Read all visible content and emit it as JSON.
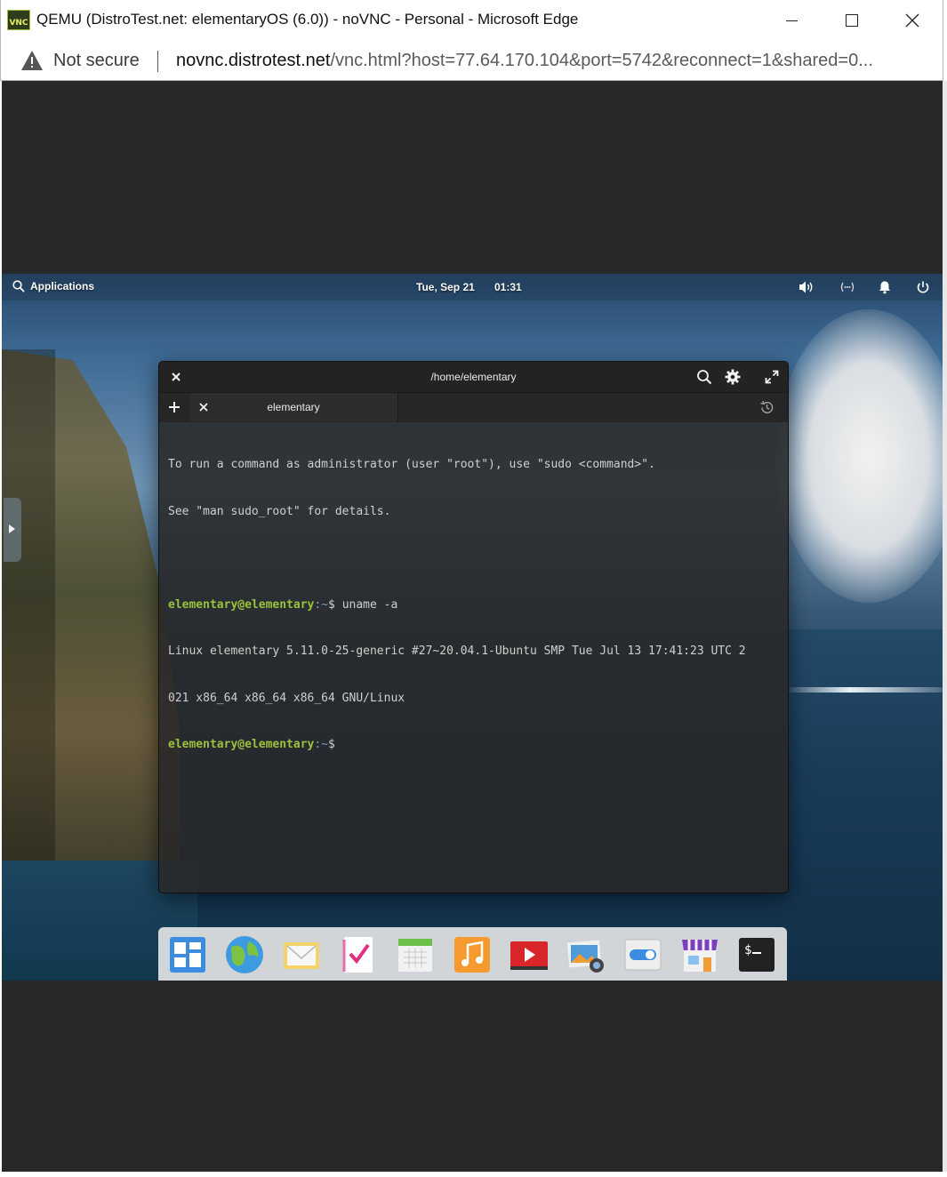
{
  "browser": {
    "title": "QEMU (DistroTest.net: elementaryOS (6.0)) - noVNC - Personal - Microsoft Edge",
    "logo_text": "VNC",
    "security_label": "Not secure",
    "url_host": "novnc.distrotest.net",
    "url_rest": "/vnc.html?host=77.64.170.104&port=5742&reconnect=1&shared=0...",
    "icons": [
      "vnc-logo-icon",
      "minimize-icon",
      "maximize-icon",
      "close-icon",
      "warning-icon"
    ]
  },
  "panel": {
    "applications_label": "Applications",
    "date": "Tue, Sep 21",
    "time": "01:31",
    "indicators": [
      "volume-icon",
      "network-icon",
      "notifications-icon",
      "power-icon"
    ]
  },
  "terminal": {
    "title": "/home/elementary",
    "tab_label": "elementary",
    "lines": {
      "l1": "To run a command as administrator (user \"root\"), use \"sudo <command>\".",
      "l2": "See \"man sudo_root\" for details.",
      "prompt_user": "elementary@elementary",
      "prompt_path": ":~",
      "prompt_sign": "$ ",
      "cmd": "uname -a",
      "out1": "Linux elementary 5.11.0-25-generic #27~20.04.1-Ubuntu SMP Tue Jul 13 17:41:23 UTC 2",
      "out2": "021 x86_64 x86_64 x86_64 GNU/Linux"
    },
    "colors": {
      "user": "#9bc23a",
      "path": "#7a9fc4",
      "text": "#cfcfcf"
    }
  },
  "dock": {
    "items": [
      "multitasking-view-icon",
      "web-browser-icon",
      "mail-icon",
      "tasks-icon",
      "calendar-icon",
      "music-icon",
      "videos-icon",
      "photos-icon",
      "system-settings-icon",
      "appcenter-icon",
      "terminal-icon"
    ]
  }
}
